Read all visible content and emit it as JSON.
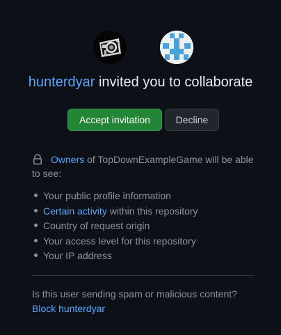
{
  "avatars": {
    "inviter": "camera-avatar",
    "repo": "identicon-avatar"
  },
  "headline": {
    "username": "hunterdyar",
    "text": " invited you to collaborate"
  },
  "buttons": {
    "accept": "Accept invitation",
    "decline": "Decline"
  },
  "permissions": {
    "lock_icon": "lock-icon",
    "owners_link": "Owners",
    "intro_text": " of TopDownExampleGame will be able to see:",
    "items": [
      {
        "link": "",
        "text": "Your public profile information"
      },
      {
        "link": "Certain activity",
        "text": " within this repository"
      },
      {
        "link": "",
        "text": "Country of request origin"
      },
      {
        "link": "",
        "text": "Your access level for this repository"
      },
      {
        "link": "",
        "text": "Your IP address"
      }
    ]
  },
  "report": {
    "question": "Is this user sending spam or malicious content?",
    "block_link": "Block hunterdyar"
  },
  "colors": {
    "background": "#0d1117",
    "link": "#58a6ff",
    "accept_green": "#238636",
    "muted_text": "#8b949e"
  }
}
